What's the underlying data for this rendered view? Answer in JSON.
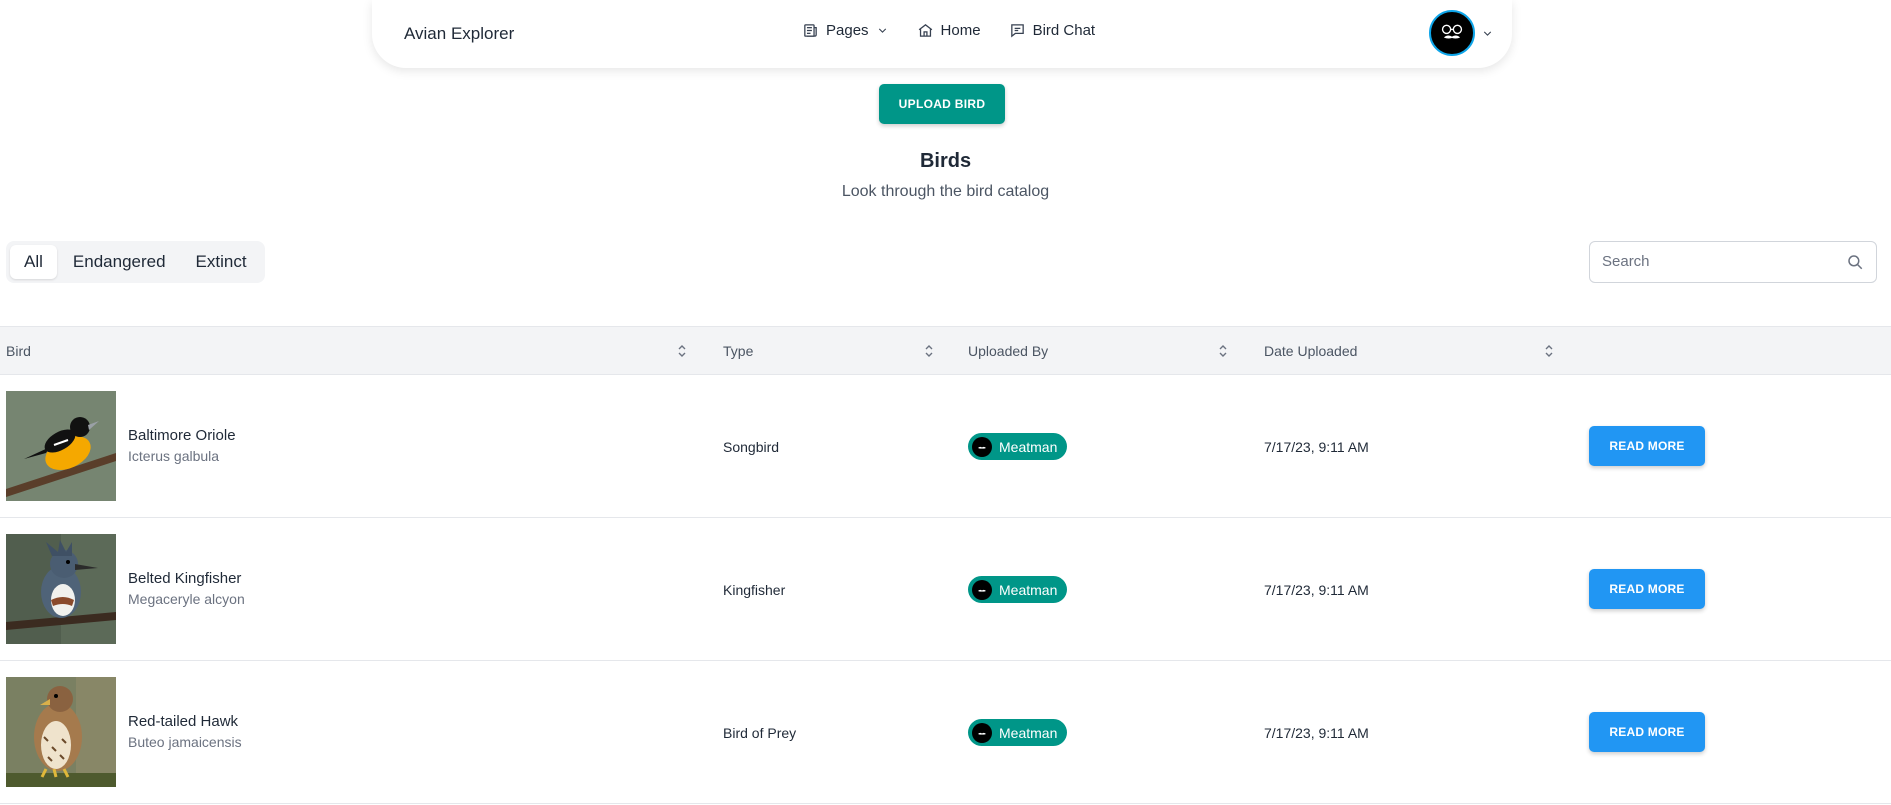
{
  "app": {
    "brand": "Avian Explorer"
  },
  "nav": {
    "items": [
      {
        "label": "Pages",
        "icon": "newspaper-icon",
        "has_dropdown": true
      },
      {
        "label": "Home",
        "icon": "home-icon"
      },
      {
        "label": "Bird Chat",
        "icon": "chat-icon"
      }
    ],
    "avatar_icon": "user-avatar-icon"
  },
  "actions": {
    "upload_label": "UPLOAD BIRD"
  },
  "page": {
    "title": "Birds",
    "subtitle": "Look through the bird catalog"
  },
  "filters": {
    "tabs": [
      "All",
      "Endangered",
      "Extinct"
    ],
    "active": "All"
  },
  "search": {
    "placeholder": "Search",
    "value": ""
  },
  "table": {
    "columns": [
      "Bird",
      "Type",
      "Uploaded By",
      "Date Uploaded"
    ],
    "read_more_label": "READ MORE",
    "rows": [
      {
        "name": "Baltimore Oriole",
        "scientific": "Icterus galbula",
        "type": "Songbird",
        "uploaded_by": "Meatman",
        "date": "7/17/23, 9:11 AM"
      },
      {
        "name": "Belted Kingfisher",
        "scientific": "Megaceryle alcyon",
        "type": "Kingfisher",
        "uploaded_by": "Meatman",
        "date": "7/17/23, 9:11 AM"
      },
      {
        "name": "Red-tailed Hawk",
        "scientific": "Buteo jamaicensis",
        "type": "Bird of Prey",
        "uploaded_by": "Meatman",
        "date": "7/17/23, 9:11 AM"
      }
    ]
  },
  "colors": {
    "teal": "#009688",
    "blue": "#2196f3",
    "header_bg": "#f3f4f6"
  }
}
